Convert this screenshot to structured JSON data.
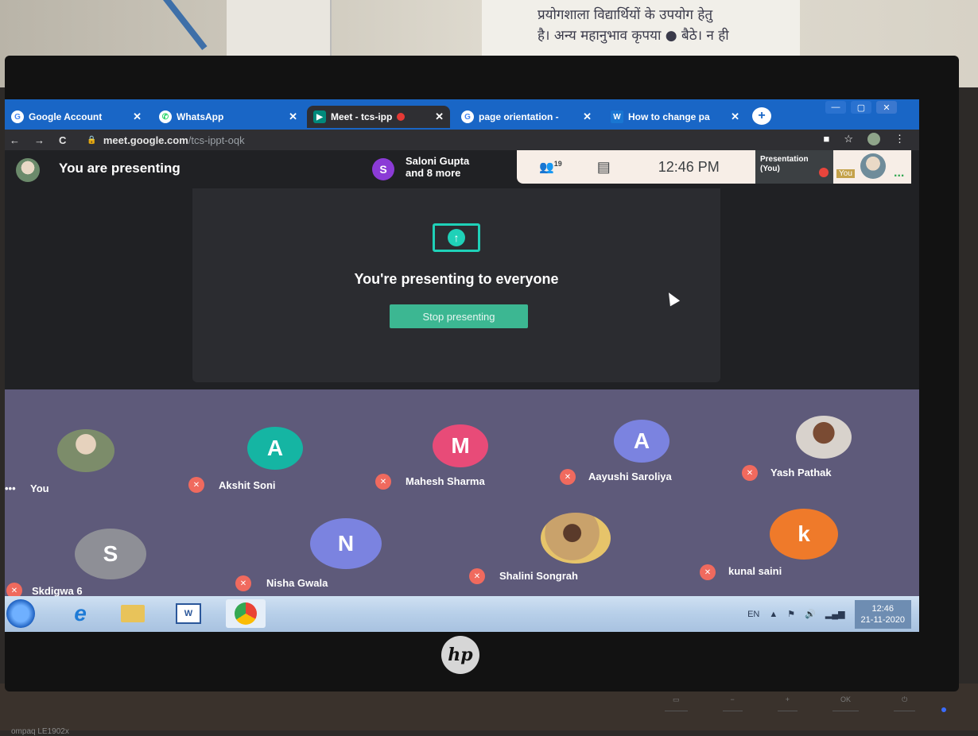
{
  "wall_notice": {
    "line1": "प्रयोगशाला विद्यार्थियों के उपयोग हेतु",
    "line2": "है। अन्य महानुभाव कृपया ● बैठे। न ही"
  },
  "tabs": [
    {
      "label": "Google Account",
      "icon": "google-icon",
      "close": "✕"
    },
    {
      "label": "WhatsApp",
      "icon": "whatsapp-icon",
      "close": "✕"
    },
    {
      "label": "Meet - tcs-ipp",
      "icon": "meet-icon",
      "close": "✕"
    },
    {
      "label": "page orientation -",
      "icon": "google-icon",
      "close": "✕"
    },
    {
      "label": "How to change pa",
      "icon": "docs-icon",
      "close": "✕"
    }
  ],
  "new_tab": "+",
  "window": {
    "minimize": "—",
    "maximize": "▢",
    "close": "✕"
  },
  "nav": {
    "back": "←",
    "forward": "→",
    "reload": "C"
  },
  "address": {
    "lock": "🔒",
    "domain": "meet.google.com",
    "path": "/tcs-ippt-oqk"
  },
  "meet": {
    "presenting_label": "You are presenting",
    "presenter_initial": "S",
    "presenter_line1": "Saloni Gupta",
    "presenter_line2": "and 8 more",
    "people_count": "19",
    "clock": "12:46 PM",
    "presentation_line1": "Presentation",
    "presentation_line2": "(You)",
    "self_tile_label": "You",
    "more": "..."
  },
  "present_card": {
    "title": "You're presenting to everyone",
    "stop_button": "Stop presenting"
  },
  "participants": [
    {
      "name": "You",
      "initial": "",
      "photo": true,
      "color": "#7c8c6a"
    },
    {
      "name": "Akshit Soni",
      "initial": "A",
      "color": "#15b5a3"
    },
    {
      "name": "Mahesh Sharma",
      "initial": "M",
      "color": "#e84b78"
    },
    {
      "name": "Aayushi Saroliya",
      "initial": "A",
      "color": "#7b83e0"
    },
    {
      "name": "Yash Pathak",
      "initial": "",
      "photo": true,
      "color": "#d8d2cc"
    },
    {
      "name": "Skdigwa 6",
      "initial": "S",
      "color": "#8e8f96"
    },
    {
      "name": "Nisha Gwala",
      "initial": "N",
      "color": "#7b83e0"
    },
    {
      "name": "Shalini Songrah",
      "initial": "",
      "photo": true,
      "color": "#c9a26b"
    },
    {
      "name": "kunal saini",
      "initial": "k",
      "color": "#ef7a2a"
    }
  ],
  "you_dots": "•••",
  "tray": {
    "lang": "EN",
    "time": "12:46",
    "date": "21-11-2020"
  },
  "monitor": {
    "model": "ompaq LE1902x",
    "brand": "hp"
  }
}
